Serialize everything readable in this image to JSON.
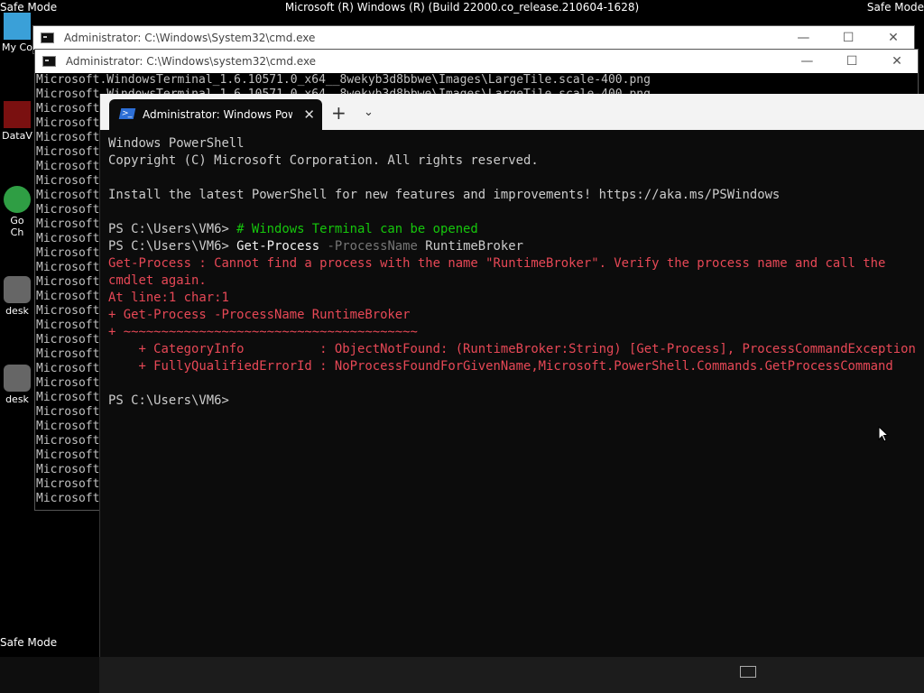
{
  "desktop": {
    "top_left_label": "Safe Mode",
    "top_right_label": "Safe Mode",
    "bottom_left_label": "Safe Mode",
    "build_label": "Microsoft (R) Windows (R) (Build 22000.co_release.210604-1628)",
    "icons": [
      {
        "label": "My Co",
        "icon": "computer-icon"
      },
      {
        "label": "DataV",
        "icon": "data-icon"
      },
      {
        "label": "Go\nCh",
        "icon": "chrome-icon"
      },
      {
        "label": "desk",
        "icon": "gear-icon"
      },
      {
        "label": "desk",
        "icon": "gear-icon"
      }
    ]
  },
  "cmd_back": {
    "title": "Administrator: C:\\Windows\\System32\\cmd.exe"
  },
  "cmd_front": {
    "title": "Administrator: C:\\Windows\\system32\\cmd.exe",
    "lines": [
      "Microsoft.WindowsTerminal_1.6.10571.0_x64__8wekyb3d8bbwe\\Images\\LargeTile.scale-400.png",
      "Microsoft.WindowsTerminal_1.6.10571.0_x64__8wekyb3d8bbwe\\Images\\LargeTile.scale-400.png",
      "Microsoft",
      "Microsoft",
      "Microsoft",
      "Microsoft",
      "Microsoft",
      "Microsoft",
      "Microsoft",
      "Microsoft",
      "Microsoft",
      "Microsoft",
      "Microsoft",
      "Microsoft",
      "Microsoft",
      "Microsoft",
      "Microsoft",
      "Microsoft",
      "Microsoft",
      "Microsoft",
      "Microsoft",
      "Microsoft",
      "Microsoft",
      "Microsoft",
      "Microsoft",
      "Microsoft",
      "Microsoft",
      "Microsoft",
      "Microsoft",
      "Microsoft"
    ]
  },
  "terminal": {
    "tab_title": "Administrator: Windows PowerS",
    "tab_close": "✕",
    "new_tab": "+",
    "dropdown": "⌄",
    "lines": [
      [
        {
          "t": "Windows PowerShell",
          "c": "default"
        }
      ],
      [
        {
          "t": "Copyright (C) Microsoft Corporation. All rights reserved.",
          "c": "default"
        }
      ],
      [
        {
          "t": "",
          "c": "default"
        }
      ],
      [
        {
          "t": "Install the latest PowerShell for new features and improvements! https://aka.ms/PSWindows",
          "c": "default"
        }
      ],
      [
        {
          "t": "",
          "c": "default"
        }
      ],
      [
        {
          "t": "PS C:\\Users\\VM6> ",
          "c": "default"
        },
        {
          "t": "# Windows Terminal can be opened",
          "c": "green"
        }
      ],
      [
        {
          "t": "PS C:\\Users\\VM6> ",
          "c": "default"
        },
        {
          "t": "Get-Process",
          "c": "white"
        },
        {
          "t": " -ProcessName",
          "c": "param"
        },
        {
          "t": " RuntimeBroker",
          "c": "default"
        }
      ],
      [
        {
          "t": "Get-Process : Cannot find a process with the name \"RuntimeBroker\". Verify the process name and call the",
          "c": "red"
        }
      ],
      [
        {
          "t": "cmdlet again.",
          "c": "red"
        }
      ],
      [
        {
          "t": "At line:1 char:1",
          "c": "red"
        }
      ],
      [
        {
          "t": "+ Get-Process -ProcessName RuntimeBroker",
          "c": "red"
        }
      ],
      [
        {
          "t": "+ ~~~~~~~~~~~~~~~~~~~~~~~~~~~~~~~~~~~~~~~",
          "c": "red"
        }
      ],
      [
        {
          "t": "    + CategoryInfo          : ObjectNotFound: (RuntimeBroker:String) [Get-Process], ProcessCommandException",
          "c": "red"
        }
      ],
      [
        {
          "t": "    + FullyQualifiedErrorId : NoProcessFoundForGivenName,Microsoft.PowerShell.Commands.GetProcessCommand",
          "c": "red"
        }
      ],
      [
        {
          "t": "",
          "c": "default"
        }
      ],
      [
        {
          "t": "PS C:\\Users\\VM6>",
          "c": "default"
        }
      ]
    ]
  },
  "window_buttons": {
    "minimize": "—",
    "maximize": "☐",
    "close": "✕"
  }
}
